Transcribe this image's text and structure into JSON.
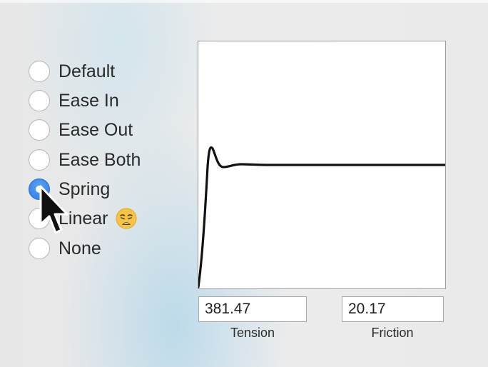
{
  "easing_options": [
    {
      "label": "Default",
      "checked": false
    },
    {
      "label": "Ease In",
      "checked": false
    },
    {
      "label": "Ease Out",
      "checked": false
    },
    {
      "label": "Ease Both",
      "checked": false
    },
    {
      "label": "Spring",
      "checked": true
    },
    {
      "label": "Linear",
      "checked": false
    },
    {
      "label": "None",
      "checked": false
    }
  ],
  "linear_emoji": "weary-face-emoji",
  "tension": {
    "value": "381.47",
    "label": "Tension"
  },
  "friction": {
    "value": "20.17",
    "label": "Friction"
  },
  "colors": {
    "accent": "#2a7ce8",
    "curve": "#111111"
  }
}
